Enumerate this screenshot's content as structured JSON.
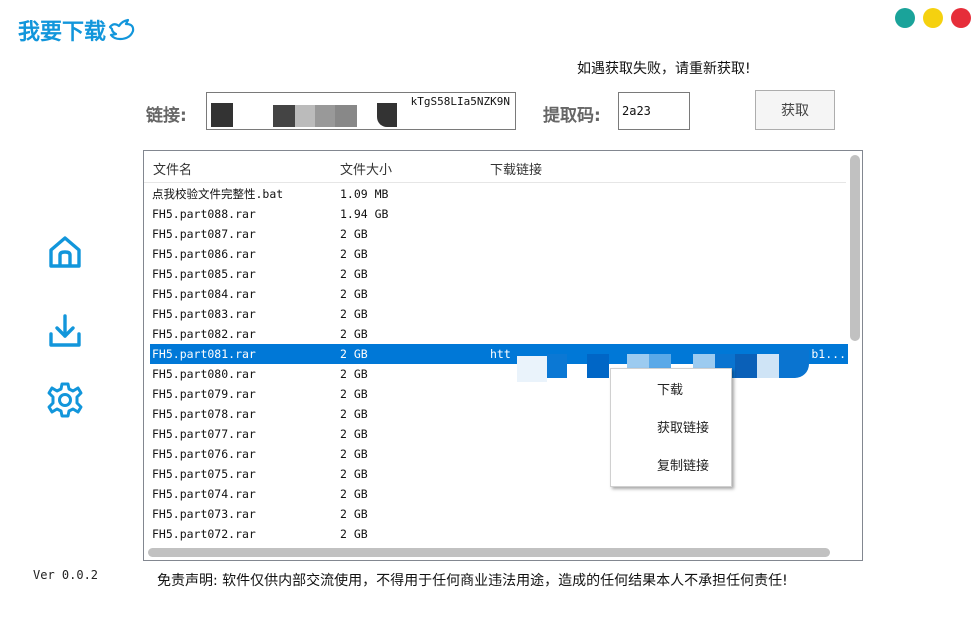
{
  "app": {
    "title": "我要下载",
    "brand_color": "#1296db",
    "logo_icon": "bird-icon",
    "window_dots": [
      "#1aa39a",
      "#f5d10f",
      "#e62e3a"
    ]
  },
  "notice": "如遇获取失败，请重新获取!",
  "link": {
    "label": "链接:",
    "value_visible_tail": "kTgS58LIa5NZK9N"
  },
  "code": {
    "label": "提取码:",
    "value": "2a23"
  },
  "fetch_button": "获取",
  "sidebar": [
    {
      "name": "home-icon"
    },
    {
      "name": "download-icon"
    },
    {
      "name": "settings-icon"
    }
  ],
  "version": "Ver 0.0.2",
  "table": {
    "headers": [
      "文件名",
      "文件大小",
      "下载链接"
    ],
    "rows": [
      {
        "name": "点我校验文件完整性.bat",
        "size": "1.09 MB",
        "link": "",
        "link_end": ""
      },
      {
        "name": "FH5.part088.rar",
        "size": "1.94 GB",
        "link": "",
        "link_end": ""
      },
      {
        "name": "FH5.part087.rar",
        "size": "2 GB",
        "link": "",
        "link_end": ""
      },
      {
        "name": "FH5.part086.rar",
        "size": "2 GB",
        "link": "",
        "link_end": ""
      },
      {
        "name": "FH5.part085.rar",
        "size": "2 GB",
        "link": "",
        "link_end": ""
      },
      {
        "name": "FH5.part084.rar",
        "size": "2 GB",
        "link": "",
        "link_end": ""
      },
      {
        "name": "FH5.part083.rar",
        "size": "2 GB",
        "link": "",
        "link_end": ""
      },
      {
        "name": "FH5.part082.rar",
        "size": "2 GB",
        "link": "",
        "link_end": ""
      },
      {
        "name": "FH5.part081.rar",
        "size": "2 GB",
        "link": "htt",
        "link_end": "b1..."
      },
      {
        "name": "FH5.part080.rar",
        "size": "2 GB",
        "link": "",
        "link_end": ""
      },
      {
        "name": "FH5.part079.rar",
        "size": "2 GB",
        "link": "",
        "link_end": ""
      },
      {
        "name": "FH5.part078.rar",
        "size": "2 GB",
        "link": "",
        "link_end": ""
      },
      {
        "name": "FH5.part077.rar",
        "size": "2 GB",
        "link": "",
        "link_end": ""
      },
      {
        "name": "FH5.part076.rar",
        "size": "2 GB",
        "link": "",
        "link_end": ""
      },
      {
        "name": "FH5.part075.rar",
        "size": "2 GB",
        "link": "",
        "link_end": ""
      },
      {
        "name": "FH5.part074.rar",
        "size": "2 GB",
        "link": "",
        "link_end": ""
      },
      {
        "name": "FH5.part073.rar",
        "size": "2 GB",
        "link": "",
        "link_end": ""
      },
      {
        "name": "FH5.part072.rar",
        "size": "2 GB",
        "link": "",
        "link_end": ""
      }
    ],
    "selected_index": 8,
    "selection_color": "#0078d7"
  },
  "context_menu": [
    "下载",
    "获取链接",
    "复制链接"
  ],
  "disclaimer": "免责声明: 软件仅供内部交流使用，不得用于任何商业违法用途，造成的任何结果本人不承担任何责任!"
}
